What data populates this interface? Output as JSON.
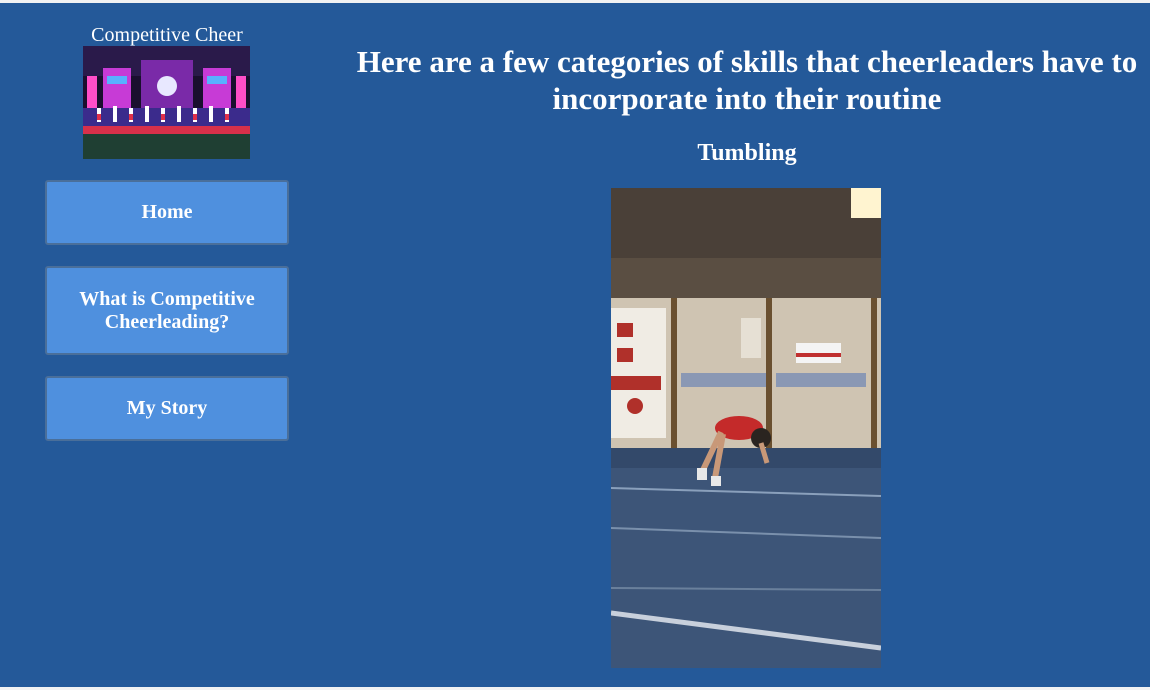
{
  "sidebar": {
    "site_title": "Competitive Cheer",
    "logo_icon": "cheer-team-stage-photo",
    "nav": {
      "home": "Home",
      "what_is": "What is Competitive Cheerleading?",
      "my_story": "My Story"
    }
  },
  "main": {
    "heading": "Here are a few categories of skills that cheerleaders have to incorporate into their routine",
    "section_title": "Tumbling",
    "media_icon": "tumbling-gym-photo"
  },
  "colors": {
    "background": "#245999",
    "nav_button": "#4f90de",
    "text": "#ffffff"
  }
}
